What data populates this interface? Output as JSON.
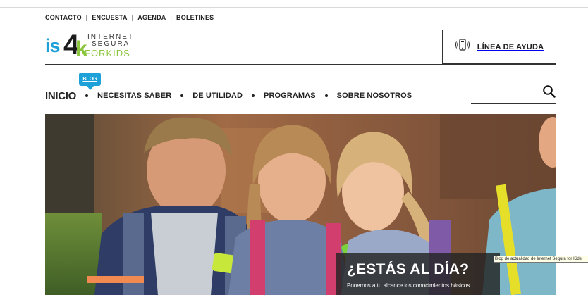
{
  "top_links": [
    "CONTACTO",
    "ENCUESTA",
    "AGENDA",
    "BOLETINES"
  ],
  "top_links_separator": "|",
  "logo": {
    "is": "is",
    "four": "4",
    "k": "k",
    "line1": "INTERNET",
    "line2": "SEGURA",
    "line3": "FORKIDS"
  },
  "help": {
    "label": "LÍNEA DE AYUDA",
    "icon": "phone-ringing-icon"
  },
  "blog_badge": "BLOG",
  "nav": {
    "home": "INICIO",
    "items": [
      "NECESITAS SABER",
      "DE UTILIDAD",
      "PROGRAMAS",
      "SOBRE NOSOTROS"
    ]
  },
  "search": {
    "placeholder": "",
    "icon": "search-icon"
  },
  "hero": {
    "title": "¿ESTÁS AL DÍA?",
    "subtitle": "Ponemos a tu alcance los conocimientos básicos"
  },
  "tooltip": "Blog de actualidad de Internet Segura for Kids",
  "colors": {
    "brand_blue": "#1ea0d8",
    "brand_green": "#8cc63f",
    "text_dark": "#222222"
  }
}
